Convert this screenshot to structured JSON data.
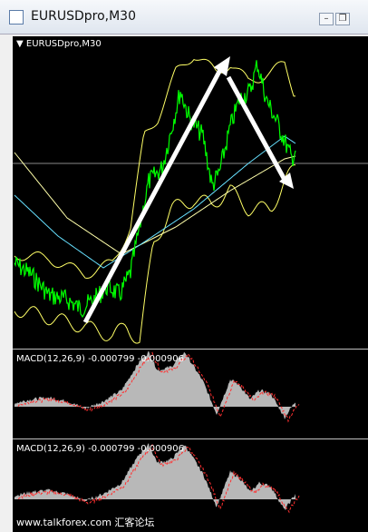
{
  "window": {
    "title": "EURUSDpro,M30"
  },
  "chart": {
    "symbol_label": "EURUSDpro,M30",
    "colors": {
      "background": "#000000",
      "price": "#00ff00",
      "bands": "#ffff66",
      "ma_slow": "#ffffaa",
      "ma_cyan": "#66e0ff",
      "arrows": "#ffffff"
    }
  },
  "macd_top": {
    "label": "MACD(12,26,9) -0.000799 -0.000906"
  },
  "macd_bottom": {
    "label": "MACD(12,26,9) -0.000799 -0.000906"
  },
  "watermark": {
    "text": "www.talkforex.com 汇客论坛"
  },
  "icons": {
    "chart_menu": "triangle-down-icon",
    "window_icon": "chart-window-icon"
  }
}
